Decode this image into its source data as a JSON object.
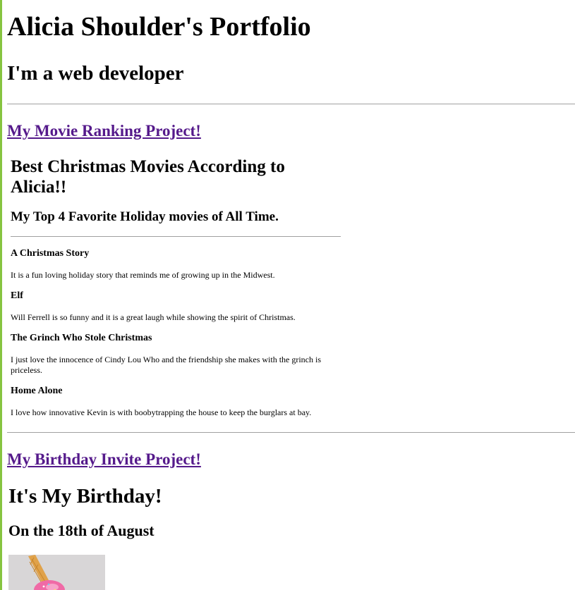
{
  "header": {
    "title": "Alicia Shoulder's Portfolio",
    "subtitle": "I'm a web developer"
  },
  "projects": {
    "movie_link": "My Movie Ranking Project!",
    "birthday_link": "My Birthday Invite Project!"
  },
  "movie_embed": {
    "title": "Best Christmas Movies According to Alicia!!",
    "subtitle": "My Top 4 Favorite Holiday movies of All Time.",
    "movies": [
      {
        "name": "A Christmas Story",
        "description": "It is a fun loving holiday story that reminds me of growing up in the Midwest."
      },
      {
        "name": "Elf",
        "description": "Will Ferrell is so funny and it is a great laugh while showing the spirit of Christmas."
      },
      {
        "name": "The Grinch Who Stole Christmas",
        "description": "I just love the innocence of Cindy Lou Who and the friendship she makes with the grinch is priceless."
      },
      {
        "name": "Home Alone",
        "description": "I love how innovative Kevin is with boobytrapping the house to keep the burglars at bay."
      }
    ]
  },
  "birthday_embed": {
    "title": "It's My Birthday!",
    "date": "On the 18th of August",
    "image_icon": "ice-cream-cone-icon"
  },
  "colors": {
    "link_visited": "#551a8b",
    "frame_edge": "#86c440",
    "rule": "#a0a0a0"
  }
}
